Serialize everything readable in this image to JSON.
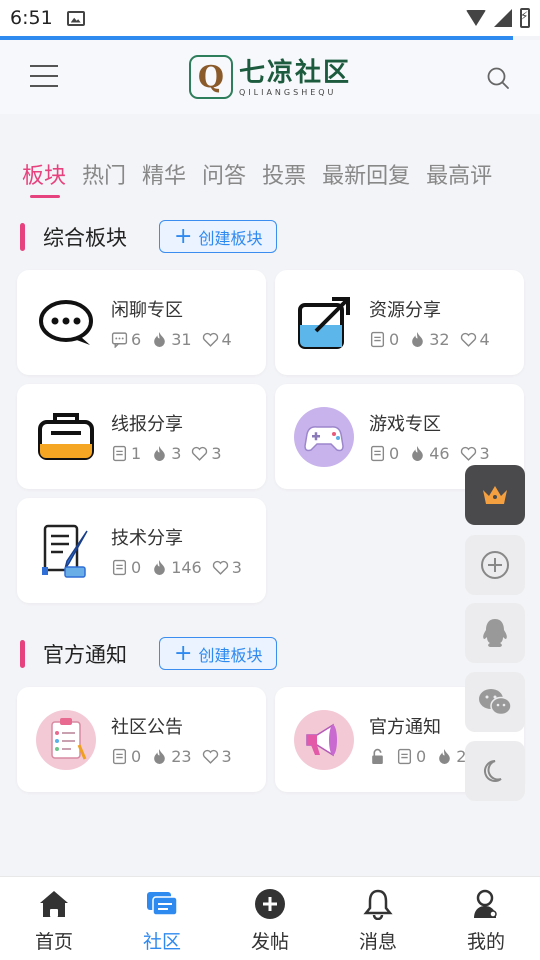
{
  "status_bar": {
    "time": "6:51"
  },
  "header": {
    "logo_mark": "Q",
    "logo_title": "七凉社区",
    "logo_subtitle": "QILIANGSHEQU"
  },
  "tabs": [
    {
      "label": "板块",
      "active": true
    },
    {
      "label": "热门"
    },
    {
      "label": "精华"
    },
    {
      "label": "问答"
    },
    {
      "label": "投票"
    },
    {
      "label": "最新回复"
    },
    {
      "label": "最高评"
    }
  ],
  "sections": [
    {
      "title": "综合板块",
      "create_label": "创建板块",
      "boards": [
        {
          "name": "闲聊专区",
          "icon": "chat-bubble-icon",
          "posts": "6",
          "heat": "31",
          "likes": "4",
          "post_icon": "comment-icon"
        },
        {
          "name": "资源分享",
          "icon": "share-arrow-icon",
          "posts": "0",
          "heat": "32",
          "likes": "4",
          "post_icon": "document-icon"
        },
        {
          "name": "线报分享",
          "icon": "inbox-tray-icon",
          "posts": "1",
          "heat": "3",
          "likes": "3",
          "post_icon": "document-icon"
        },
        {
          "name": "游戏专区",
          "icon": "gamepad-icon",
          "posts": "0",
          "heat": "46",
          "likes": "3",
          "post_icon": "document-icon"
        },
        {
          "name": "技术分享",
          "icon": "document-pen-icon",
          "posts": "0",
          "heat": "146",
          "likes": "3",
          "post_icon": "document-icon"
        }
      ]
    },
    {
      "title": "官方通知",
      "create_label": "创建板块",
      "boards": [
        {
          "name": "社区公告",
          "icon": "clipboard-icon",
          "posts": "0",
          "heat": "23",
          "likes": "3",
          "post_icon": "document-icon"
        },
        {
          "name": "官方通知",
          "icon": "megaphone-icon",
          "posts": "0",
          "heat": "2",
          "post_icon": "document-icon",
          "locked": true
        }
      ]
    }
  ],
  "fabs": [
    "crown-icon",
    "add-circle-icon",
    "qq-icon",
    "wechat-icon",
    "moon-icon"
  ],
  "bottom_nav": [
    {
      "label": "首页",
      "icon": "home-icon"
    },
    {
      "label": "社区",
      "icon": "community-icon",
      "active": true
    },
    {
      "label": "发帖",
      "icon": "post-add-icon"
    },
    {
      "label": "消息",
      "icon": "bell-icon"
    },
    {
      "label": "我的",
      "icon": "profile-icon"
    }
  ],
  "colors": {
    "accent_pink": "#e6437e",
    "accent_blue": "#2f8af0",
    "logo_green": "#1d5b3e"
  }
}
